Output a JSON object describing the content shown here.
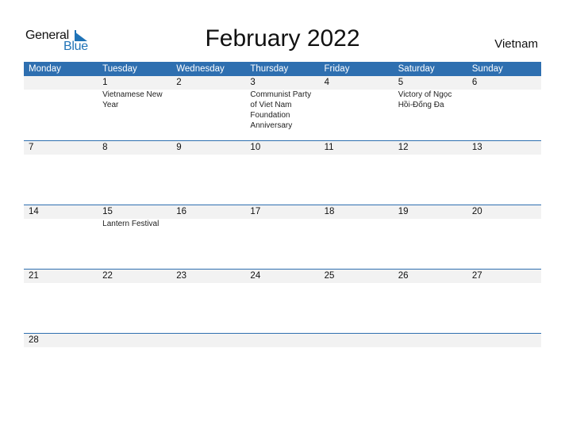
{
  "brand": {
    "general": "General",
    "blue": "Blue",
    "accent_color": "#1f73b7"
  },
  "title": "February 2022",
  "country": "Vietnam",
  "header_color": "#2e6fb0",
  "weekdays": [
    "Monday",
    "Tuesday",
    "Wednesday",
    "Thursday",
    "Friday",
    "Saturday",
    "Sunday"
  ],
  "weeks": [
    {
      "days": [
        {
          "num": "",
          "event": ""
        },
        {
          "num": "1",
          "event": "Vietnamese New Year"
        },
        {
          "num": "2",
          "event": ""
        },
        {
          "num": "3",
          "event": "Communist Party of Viet Nam Foundation Anniversary"
        },
        {
          "num": "4",
          "event": ""
        },
        {
          "num": "5",
          "event": "Victory of Ngọc Hồi-Đống Đa"
        },
        {
          "num": "6",
          "event": ""
        }
      ]
    },
    {
      "days": [
        {
          "num": "7",
          "event": ""
        },
        {
          "num": "8",
          "event": ""
        },
        {
          "num": "9",
          "event": ""
        },
        {
          "num": "10",
          "event": ""
        },
        {
          "num": "11",
          "event": ""
        },
        {
          "num": "12",
          "event": ""
        },
        {
          "num": "13",
          "event": ""
        }
      ]
    },
    {
      "days": [
        {
          "num": "14",
          "event": ""
        },
        {
          "num": "15",
          "event": "Lantern Festival"
        },
        {
          "num": "16",
          "event": ""
        },
        {
          "num": "17",
          "event": ""
        },
        {
          "num": "18",
          "event": ""
        },
        {
          "num": "19",
          "event": ""
        },
        {
          "num": "20",
          "event": ""
        }
      ]
    },
    {
      "days": [
        {
          "num": "21",
          "event": ""
        },
        {
          "num": "22",
          "event": ""
        },
        {
          "num": "23",
          "event": ""
        },
        {
          "num": "24",
          "event": ""
        },
        {
          "num": "25",
          "event": ""
        },
        {
          "num": "26",
          "event": ""
        },
        {
          "num": "27",
          "event": ""
        }
      ]
    },
    {
      "days": [
        {
          "num": "28",
          "event": ""
        },
        {
          "num": "",
          "event": ""
        },
        {
          "num": "",
          "event": ""
        },
        {
          "num": "",
          "event": ""
        },
        {
          "num": "",
          "event": ""
        },
        {
          "num": "",
          "event": ""
        },
        {
          "num": "",
          "event": ""
        }
      ]
    }
  ]
}
